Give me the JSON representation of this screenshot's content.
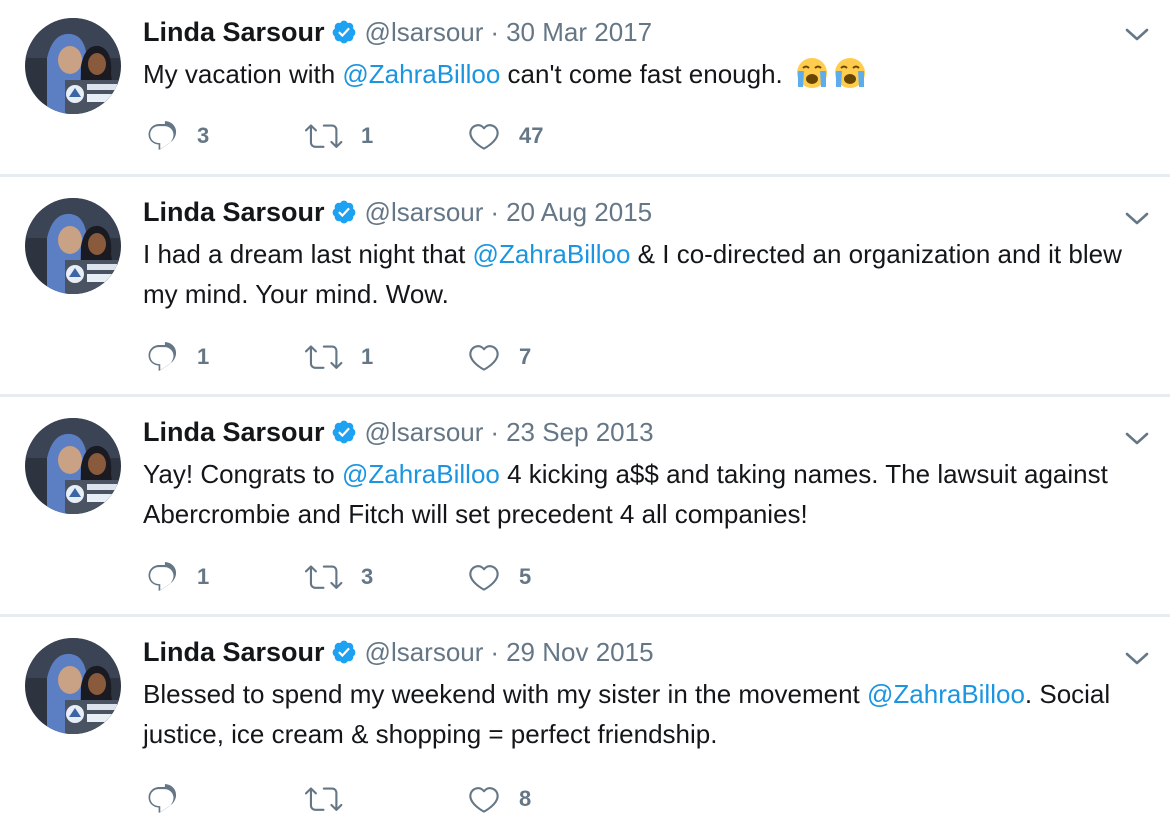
{
  "tweets": [
    {
      "name": "Linda Sarsour",
      "handle": "@lsarsour",
      "separator": "·",
      "date": "30 Mar 2017",
      "text_before": "My vacation with ",
      "mention": "@ZahraBilloo",
      "text_after": " can't come fast enough.",
      "emojis": [
        "loudly-crying-face",
        "loudly-crying-face"
      ],
      "replies": "3",
      "retweets": "1",
      "likes": "47"
    },
    {
      "name": "Linda Sarsour",
      "handle": "@lsarsour",
      "separator": "·",
      "date": "20 Aug 2015",
      "text_before": "I had a dream last night that ",
      "mention": "@ZahraBilloo",
      "text_after": " & I co-directed an organization and it blew my mind. Your mind. Wow.",
      "replies": "1",
      "retweets": "1",
      "likes": "7"
    },
    {
      "name": "Linda Sarsour",
      "handle": "@lsarsour",
      "separator": "·",
      "date": "23 Sep 2013",
      "text_before": "Yay! Congrats to ",
      "mention": "@ZahraBilloo",
      "text_after": " 4 kicking a$$ and taking names. The lawsuit against Abercrombie and Fitch will set precedent 4 all companies!",
      "replies": "1",
      "retweets": "3",
      "likes": "5"
    },
    {
      "name": "Linda Sarsour",
      "handle": "@lsarsour",
      "separator": "·",
      "date": "29 Nov 2015",
      "text_before": "Blessed to spend my weekend with my sister in the movement ",
      "mention": "@ZahraBilloo",
      "text_after": ". Social justice, ice cream & shopping = perfect friendship.",
      "replies": "",
      "retweets": "",
      "likes": "8"
    }
  ],
  "colors": {
    "mention": "#1b95e0",
    "verified": "#1da1f2",
    "secondary_text": "#657786",
    "divider": "#e6ecf0"
  },
  "icons": [
    "verified-badge-icon",
    "chevron-down-icon",
    "reply-icon",
    "retweet-icon",
    "like-heart-icon"
  ]
}
